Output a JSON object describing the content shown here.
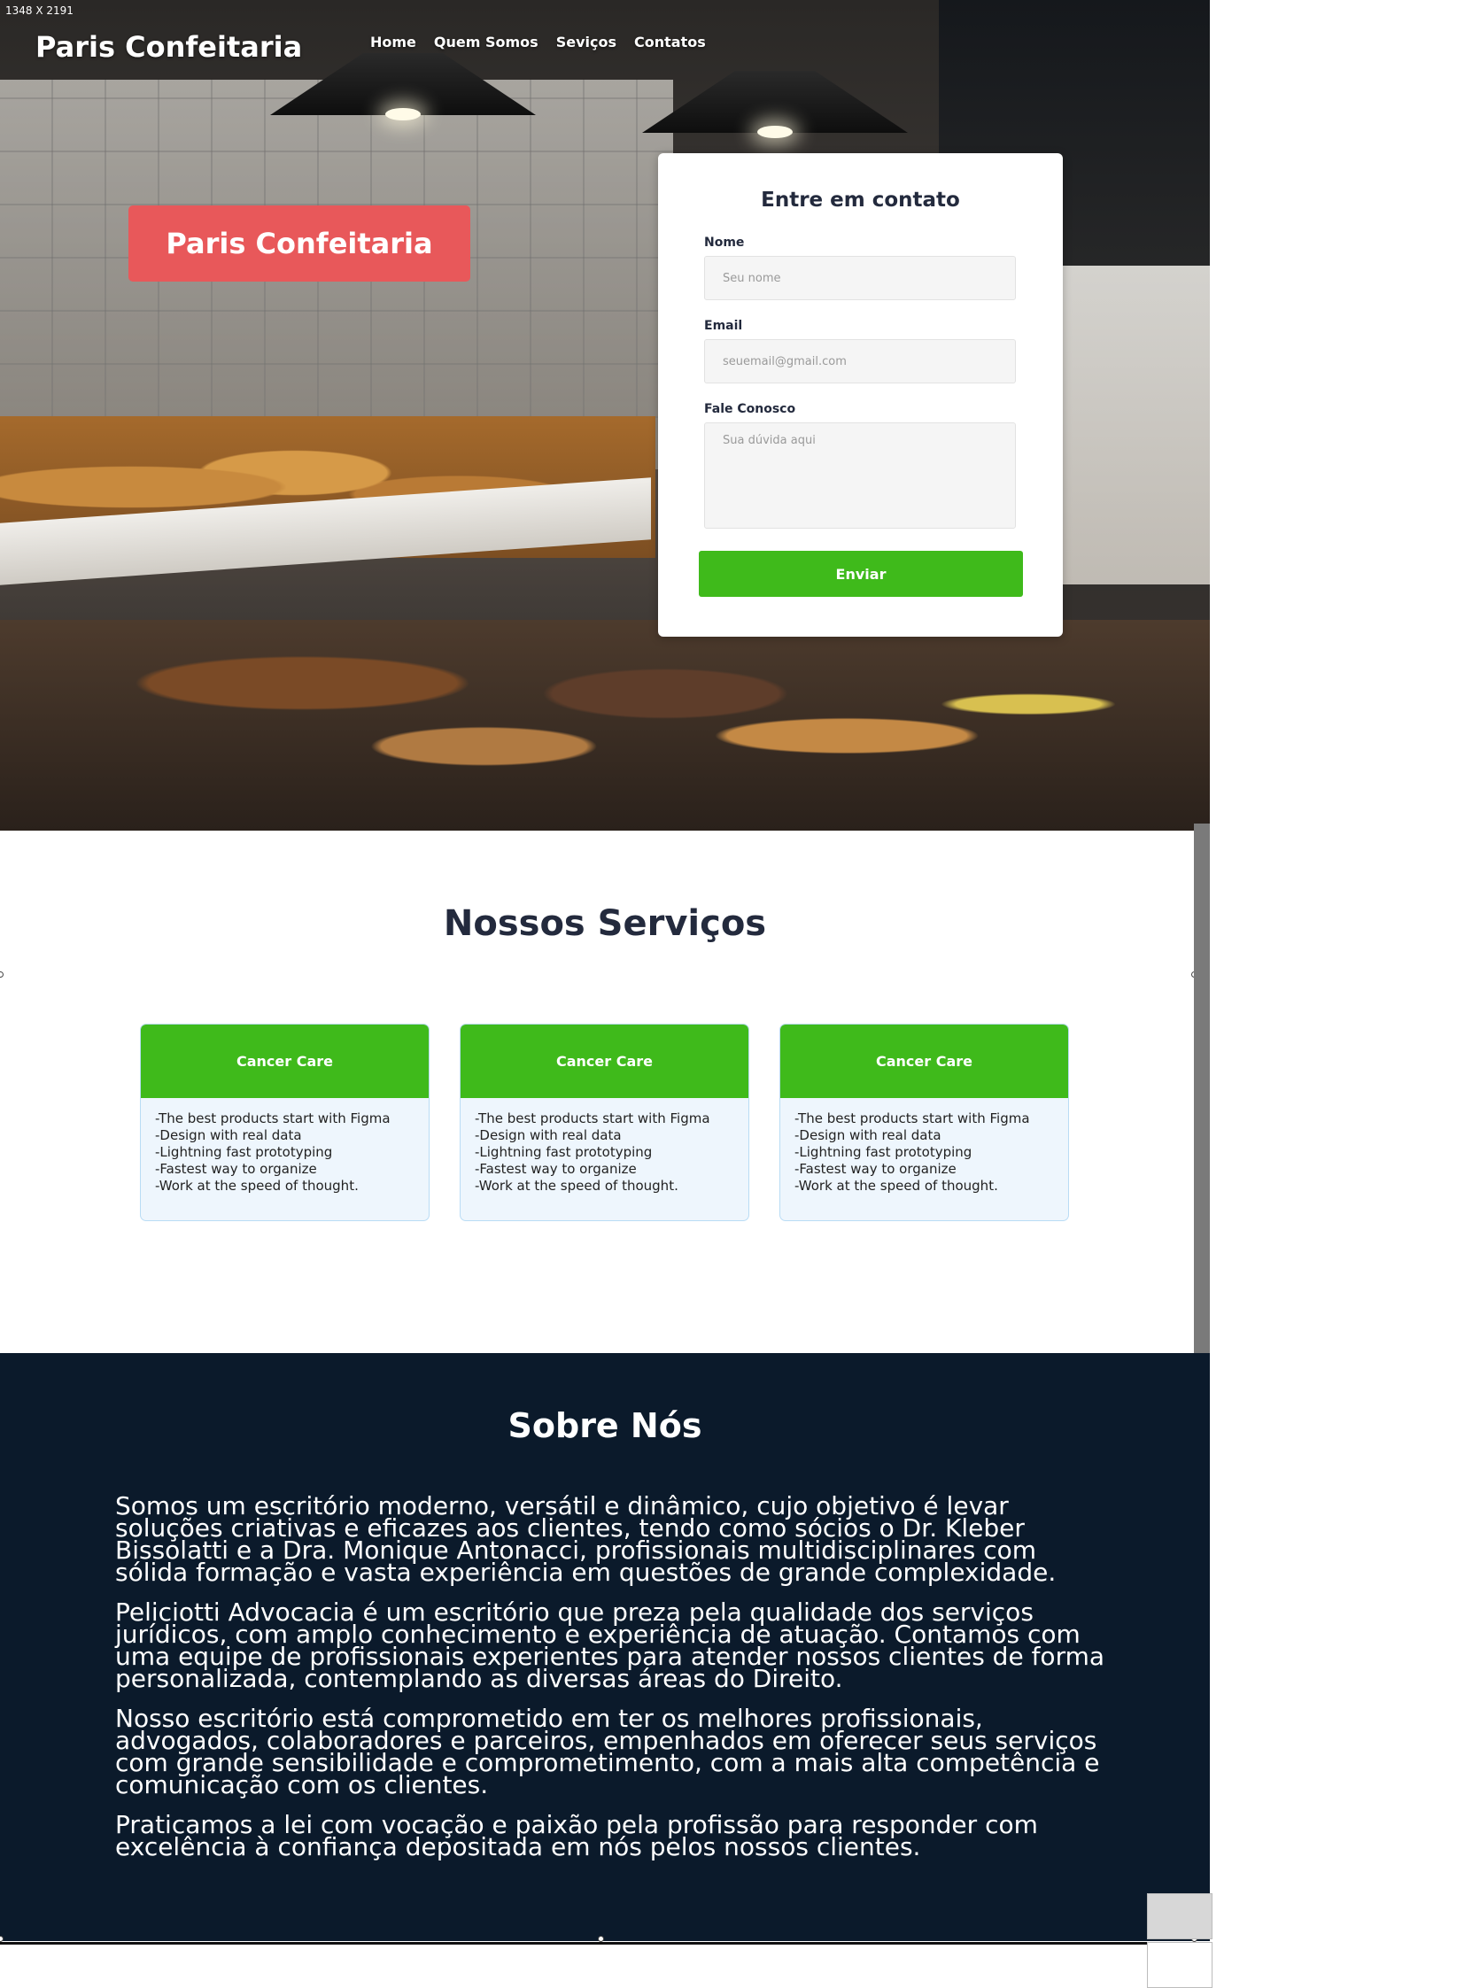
{
  "canvas_label": "1348 X 2191",
  "header": {
    "brand": "Paris Confeitaria",
    "nav": [
      "Home",
      "Quem Somos",
      "Seviços",
      "Contatos"
    ]
  },
  "hero": {
    "badge": "Paris Confeitaria"
  },
  "contact_form": {
    "title": "Entre em contato",
    "name_label": "Nome",
    "name_placeholder": "Seu nome",
    "email_label": "Email",
    "email_placeholder": "seuemail@gmail.com",
    "message_label": "Fale Conosco",
    "message_placeholder": "Sua dúvida aqui",
    "submit_label": "Enviar"
  },
  "services": {
    "title": "Nossos Serviços",
    "cards": [
      {
        "title": "Cancer Care",
        "items": [
          "-The best products start with Figma",
          "-Design with real data",
          "-Lightning fast prototyping",
          "-Fastest way to organize",
          "-Work at the speed of thought."
        ]
      },
      {
        "title": "Cancer Care",
        "items": [
          "-The best products start with Figma",
          "-Design with real data",
          "-Lightning fast prototyping",
          "-Fastest way to organize",
          "-Work at the speed of thought."
        ]
      },
      {
        "title": "Cancer Care",
        "items": [
          "-The best products start with Figma",
          "-Design with real data",
          "-Lightning fast prototyping",
          "-Fastest way to organize",
          "-Work at the speed of thought."
        ]
      }
    ]
  },
  "about": {
    "title": "Sobre Nós",
    "paragraphs": [
      "Somos um escritório moderno, versátil e dinâmico, cujo objetivo é levar soluções criativas e eficazes aos clientes, tendo como sócios o Dr. Kleber Bissolatti e a Dra. Monique Antonacci, profissionais multidisciplinares com sólida formação e vasta experiência em questões de grande complexidade.",
      "Peliciotti Advocacia é um escritório que preza pela qualidade dos serviços jurídicos, com amplo conhecimento e experiência de atuação. Contamos com uma equipe de profissionais experientes para atender nossos clientes de forma personalizada, contemplando as diversas áreas do Direito.",
      "Nosso escritório está comprometido em ter os melhores profissionais, advogados, colaboradores e parceiros, empenhados em oferecer seus serviços com grande sensibilidade e comprometimento, com a mais alta competência e comunicação com os clientes.",
      "Praticamos a lei com vocação e paixão pela profissão para responder com excelência à confiança depositada em nós pelos nossos clientes."
    ]
  },
  "colors": {
    "accent_green": "#3fba1b",
    "badge_red": "#e8585a",
    "navy": "#0b1a2b",
    "title_dark": "#232a3d"
  }
}
